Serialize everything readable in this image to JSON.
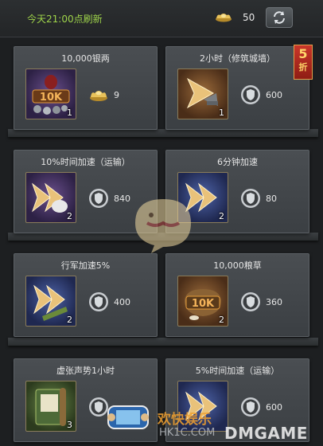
{
  "header": {
    "refresh_notice": "今天21:00点刷新",
    "currency_icon": "silver-ingot-icon",
    "currency_count": "50",
    "refresh_button_icon": "refresh-icon"
  },
  "discount_badge": {
    "number": "5",
    "label": "折"
  },
  "items": [
    {
      "title": "10,000银两",
      "quantity": "1",
      "price": "9",
      "price_icon": "silver-ingot-icon",
      "art_label": "10K"
    },
    {
      "title": "2小时（修筑城墙）",
      "quantity": "1",
      "price": "600",
      "price_icon": "shield-token-icon"
    },
    {
      "title": "10%时间加速（运输）",
      "quantity": "2",
      "price": "840",
      "price_icon": "shield-token-icon"
    },
    {
      "title": "6分钟加速",
      "quantity": "2",
      "price": "80",
      "price_icon": "shield-token-icon"
    },
    {
      "title": "行军加速5%",
      "quantity": "2",
      "price": "400",
      "price_icon": "shield-token-icon"
    },
    {
      "title": "10,000粮草",
      "quantity": "2",
      "price": "360",
      "price_icon": "shield-token-icon",
      "art_label": "10K"
    },
    {
      "title": "虚张声势1小时",
      "quantity": "3",
      "price": "",
      "price_icon": "shield-token-icon"
    },
    {
      "title": "5%时间加速（运输）",
      "quantity": "",
      "price": "600",
      "price_icon": "shield-token-icon"
    }
  ],
  "watermark": {
    "text_1": "欢快娱乐",
    "text_2": "HK1C.COM",
    "text_3": "DMGAME"
  },
  "colors": {
    "refresh_notice": "#9ed34a",
    "background": "#1d1f21",
    "card": "#44484c",
    "discount": "#c9362a"
  }
}
